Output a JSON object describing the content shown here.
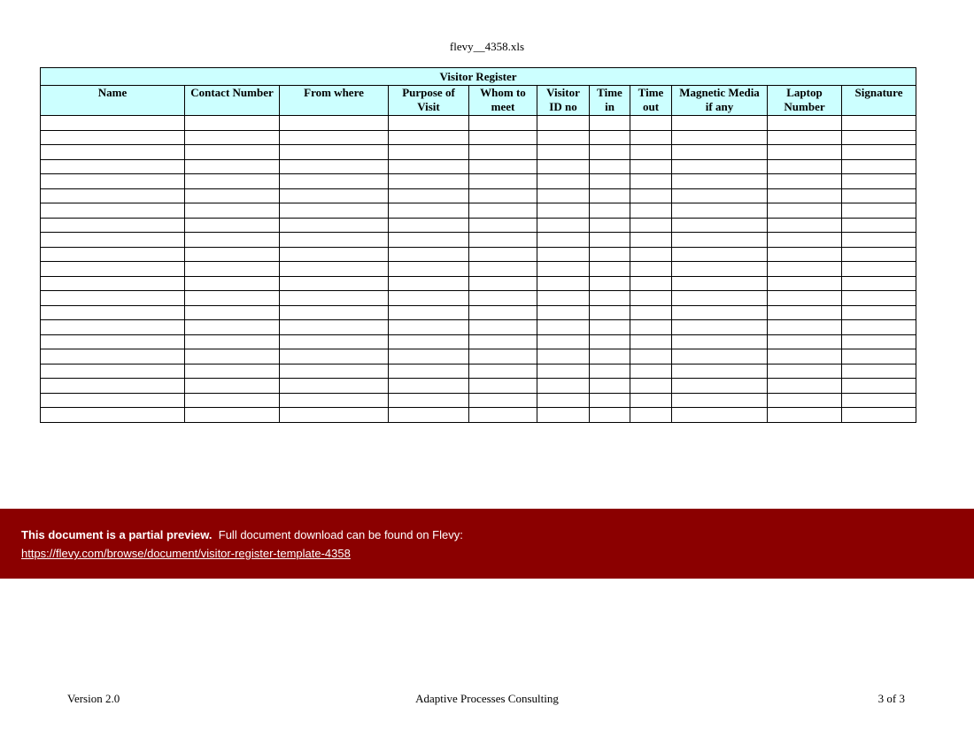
{
  "document": {
    "file_title": "flevy__4358.xls"
  },
  "register": {
    "title": "Visitor Register",
    "columns": [
      {
        "line1": "Name",
        "line2": ""
      },
      {
        "line1": "Contact Number",
        "line2": ""
      },
      {
        "line1": "From where",
        "line2": ""
      },
      {
        "line1": "Purpose of",
        "line2": "Visit"
      },
      {
        "line1": "Whom to",
        "line2": "meet"
      },
      {
        "line1": "Visitor",
        "line2": "ID no"
      },
      {
        "line1": "Time",
        "line2": "in"
      },
      {
        "line1": "Time",
        "line2": "out"
      },
      {
        "line1": "Magnetic Media",
        "line2": "if any"
      },
      {
        "line1": "Laptop",
        "line2": "Number"
      },
      {
        "line1": "Signature",
        "line2": ""
      }
    ],
    "empty_row_count": 21,
    "header_bg": "#ccffff"
  },
  "banner": {
    "bold_text": "This document is a partial preview.",
    "text": "Full document download can be found on Flevy:",
    "link": "https://flevy.com/browse/document/visitor-register-template-4358",
    "bg_color": "#8b0000"
  },
  "footer": {
    "version": "Version 2.0",
    "company": "Adaptive Processes Consulting",
    "page": "3 of 3"
  }
}
